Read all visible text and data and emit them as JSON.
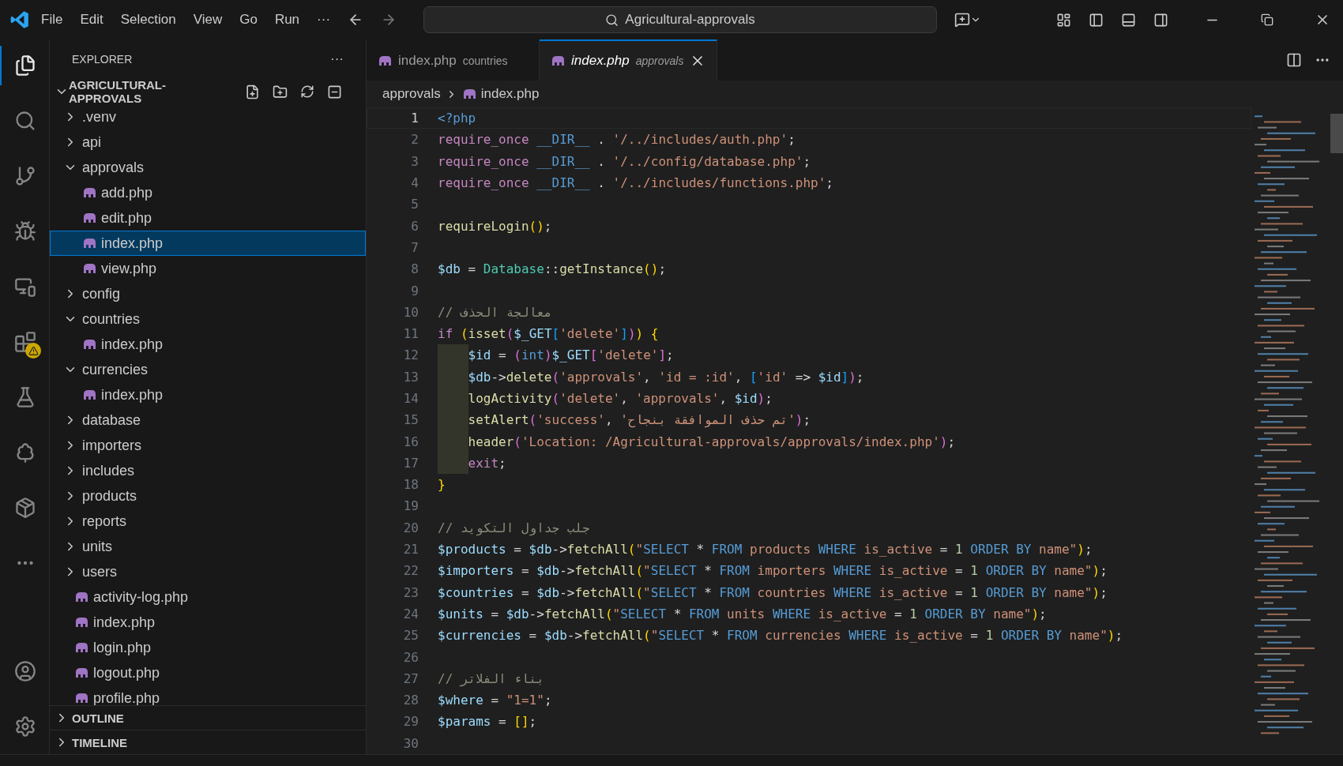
{
  "menu": [
    "File",
    "Edit",
    "Selection",
    "View",
    "Go",
    "Run",
    "···"
  ],
  "search": {
    "value": "Agricultural-approvals"
  },
  "sidebar": {
    "title": "EXPLORER",
    "more": "···",
    "root": {
      "label": "AGRICULTURAL-APPROVALS",
      "expanded": true
    },
    "tree": [
      {
        "label": ".venv",
        "kind": "folder",
        "expanded": false,
        "selected": false
      },
      {
        "label": "api",
        "kind": "folder",
        "expanded": false,
        "selected": false
      },
      {
        "label": "approvals",
        "kind": "folder",
        "expanded": true,
        "selected": false,
        "children": [
          {
            "label": "add.php",
            "kind": "file",
            "selected": false
          },
          {
            "label": "edit.php",
            "kind": "file",
            "selected": false
          },
          {
            "label": "index.php",
            "kind": "file",
            "selected": true
          },
          {
            "label": "view.php",
            "kind": "file",
            "selected": false
          }
        ]
      },
      {
        "label": "config",
        "kind": "folder",
        "expanded": false,
        "selected": false
      },
      {
        "label": "countries",
        "kind": "folder",
        "expanded": true,
        "selected": false,
        "children": [
          {
            "label": "index.php",
            "kind": "file",
            "selected": false
          }
        ]
      },
      {
        "label": "currencies",
        "kind": "folder",
        "expanded": true,
        "selected": false,
        "children": [
          {
            "label": "index.php",
            "kind": "file",
            "selected": false
          }
        ]
      },
      {
        "label": "database",
        "kind": "folder",
        "expanded": false,
        "selected": false
      },
      {
        "label": "importers",
        "kind": "folder",
        "expanded": false,
        "selected": false
      },
      {
        "label": "includes",
        "kind": "folder",
        "expanded": false,
        "selected": false
      },
      {
        "label": "products",
        "kind": "folder",
        "expanded": false,
        "selected": false
      },
      {
        "label": "reports",
        "kind": "folder",
        "expanded": false,
        "selected": false
      },
      {
        "label": "units",
        "kind": "folder",
        "expanded": false,
        "selected": false
      },
      {
        "label": "users",
        "kind": "folder",
        "expanded": false,
        "selected": false
      },
      {
        "label": "activity-log.php",
        "kind": "file",
        "selected": false
      },
      {
        "label": "index.php",
        "kind": "file",
        "selected": false
      },
      {
        "label": "login.php",
        "kind": "file",
        "selected": false
      },
      {
        "label": "logout.php",
        "kind": "file",
        "selected": false
      },
      {
        "label": "profile.php",
        "kind": "file",
        "selected": false
      }
    ],
    "sections": [
      {
        "label": "OUTLINE",
        "expanded": false
      },
      {
        "label": "TIMELINE",
        "expanded": false
      }
    ]
  },
  "tabs": [
    {
      "label": "index.php",
      "description": "countries",
      "selected": false,
      "preview": false
    },
    {
      "label": "index.php",
      "description": "approvals",
      "selected": true,
      "preview": true
    }
  ],
  "breadcrumb": [
    "approvals",
    "index.php"
  ],
  "lines": [
    {
      "number": "1",
      "current": true,
      "guide": false,
      "tokens": [
        {
          "kind": "tag",
          "text": "<?php"
        }
      ]
    },
    {
      "number": "2",
      "current": false,
      "guide": false,
      "tokens": [
        {
          "kind": "kw",
          "text": "require_once "
        },
        {
          "kind": "const",
          "text": "__DIR__"
        },
        {
          "kind": "plain",
          "text": " . "
        },
        {
          "kind": "str",
          "text": "'/../includes/auth.php'"
        },
        {
          "kind": "plain",
          "text": ";"
        }
      ]
    },
    {
      "number": "3",
      "current": false,
      "guide": false,
      "tokens": [
        {
          "kind": "kw",
          "text": "require_once "
        },
        {
          "kind": "const",
          "text": "__DIR__"
        },
        {
          "kind": "plain",
          "text": " . "
        },
        {
          "kind": "str",
          "text": "'/../config/database.php'"
        },
        {
          "kind": "plain",
          "text": ";"
        }
      ]
    },
    {
      "number": "4",
      "current": false,
      "guide": false,
      "tokens": [
        {
          "kind": "kw",
          "text": "require_once "
        },
        {
          "kind": "const",
          "text": "__DIR__"
        },
        {
          "kind": "plain",
          "text": " . "
        },
        {
          "kind": "str",
          "text": "'/../includes/functions.php'"
        },
        {
          "kind": "plain",
          "text": ";"
        }
      ]
    },
    {
      "number": "5",
      "current": false,
      "guide": false
    },
    {
      "number": "6",
      "current": false,
      "guide": false,
      "tokens": [
        {
          "kind": "fn",
          "text": "requireLogin"
        },
        {
          "kind": "b1",
          "text": "()"
        },
        {
          "kind": "plain",
          "text": ";"
        }
      ]
    },
    {
      "number": "7",
      "current": false,
      "guide": false
    },
    {
      "number": "8",
      "current": false,
      "guide": false,
      "tokens": [
        {
          "kind": "var",
          "text": "$db"
        },
        {
          "kind": "plain",
          "text": " = "
        },
        {
          "kind": "cls",
          "text": "Database"
        },
        {
          "kind": "plain",
          "text": "::"
        },
        {
          "kind": "fn",
          "text": "getInstance"
        },
        {
          "kind": "b1",
          "text": "()"
        },
        {
          "kind": "plain",
          "text": ";"
        }
      ]
    },
    {
      "number": "9",
      "current": false,
      "guide": false
    },
    {
      "number": "10",
      "current": false,
      "guide": false,
      "tokens": [
        {
          "kind": "cmt",
          "text": "// معالجة الحذف"
        }
      ]
    },
    {
      "number": "11",
      "current": false,
      "guide": false,
      "tokens": [
        {
          "kind": "kw",
          "text": "if "
        },
        {
          "kind": "b1",
          "text": "("
        },
        {
          "kind": "fn",
          "text": "isset"
        },
        {
          "kind": "b2",
          "text": "("
        },
        {
          "kind": "var",
          "text": "$_GET"
        },
        {
          "kind": "b3",
          "text": "["
        },
        {
          "kind": "str",
          "text": "'delete'"
        },
        {
          "kind": "b3",
          "text": "]"
        },
        {
          "kind": "b2",
          "text": ")"
        },
        {
          "kind": "b1",
          "text": ")"
        },
        {
          "kind": "b1",
          "text": " {"
        }
      ]
    },
    {
      "number": "12",
      "current": false,
      "guide": true,
      "tokens": [
        {
          "kind": "var",
          "text": "$id"
        },
        {
          "kind": "plain",
          "text": " = "
        },
        {
          "kind": "b2",
          "text": "("
        },
        {
          "kind": "const",
          "text": "int"
        },
        {
          "kind": "b2",
          "text": ")"
        },
        {
          "kind": "var",
          "text": "$_GET"
        },
        {
          "kind": "b2",
          "text": "["
        },
        {
          "kind": "str",
          "text": "'delete'"
        },
        {
          "kind": "b2",
          "text": "]"
        },
        {
          "kind": "plain",
          "text": ";"
        }
      ]
    },
    {
      "number": "13",
      "current": false,
      "guide": true,
      "tokens": [
        {
          "kind": "var",
          "text": "$db"
        },
        {
          "kind": "plain",
          "text": "->"
        },
        {
          "kind": "fn",
          "text": "delete"
        },
        {
          "kind": "b2",
          "text": "("
        },
        {
          "kind": "str",
          "text": "'approvals'"
        },
        {
          "kind": "plain",
          "text": ", "
        },
        {
          "kind": "str",
          "text": "'id = :id'"
        },
        {
          "kind": "plain",
          "text": ", "
        },
        {
          "kind": "b3",
          "text": "["
        },
        {
          "kind": "str",
          "text": "'id'"
        },
        {
          "kind": "plain",
          "text": " => "
        },
        {
          "kind": "var",
          "text": "$id"
        },
        {
          "kind": "b3",
          "text": "]"
        },
        {
          "kind": "b2",
          "text": ")"
        },
        {
          "kind": "plain",
          "text": ";"
        }
      ]
    },
    {
      "number": "14",
      "current": false,
      "guide": true,
      "tokens": [
        {
          "kind": "fn",
          "text": "logActivity"
        },
        {
          "kind": "b2",
          "text": "("
        },
        {
          "kind": "str",
          "text": "'delete'"
        },
        {
          "kind": "plain",
          "text": ", "
        },
        {
          "kind": "str",
          "text": "'approvals'"
        },
        {
          "kind": "plain",
          "text": ", "
        },
        {
          "kind": "var",
          "text": "$id"
        },
        {
          "kind": "b2",
          "text": ")"
        },
        {
          "kind": "plain",
          "text": ";"
        }
      ]
    },
    {
      "number": "15",
      "current": false,
      "guide": true,
      "tokens": [
        {
          "kind": "fn",
          "text": "setAlert"
        },
        {
          "kind": "b2",
          "text": "("
        },
        {
          "kind": "str",
          "text": "'success'"
        },
        {
          "kind": "plain",
          "text": ", "
        },
        {
          "kind": "str",
          "text": "'تم حذف الموافقة بنجاح'"
        },
        {
          "kind": "b2",
          "text": ")"
        },
        {
          "kind": "plain",
          "text": ";"
        }
      ]
    },
    {
      "number": "16",
      "current": false,
      "guide": true,
      "tokens": [
        {
          "kind": "fn",
          "text": "header"
        },
        {
          "kind": "b2",
          "text": "("
        },
        {
          "kind": "str",
          "text": "'Location: /Agricultural-approvals/approvals/index.php'"
        },
        {
          "kind": "b2",
          "text": ")"
        },
        {
          "kind": "plain",
          "text": ";"
        }
      ]
    },
    {
      "number": "17",
      "current": false,
      "guide": true,
      "tokens": [
        {
          "kind": "kw",
          "text": "exit"
        },
        {
          "kind": "plain",
          "text": ";"
        }
      ]
    },
    {
      "number": "18",
      "current": false,
      "guide": false,
      "tokens": [
        {
          "kind": "b1",
          "text": "}"
        }
      ]
    },
    {
      "number": "19",
      "current": false,
      "guide": false
    },
    {
      "number": "20",
      "current": false,
      "guide": false,
      "tokens": [
        {
          "kind": "cmt",
          "text": "// جلب جداول التكويد"
        }
      ]
    },
    {
      "number": "21",
      "current": false,
      "guide": false,
      "tokens": [
        {
          "kind": "var",
          "text": "$products"
        },
        {
          "kind": "plain",
          "text": " = "
        },
        {
          "kind": "var",
          "text": "$db"
        },
        {
          "kind": "plain",
          "text": "->"
        },
        {
          "kind": "fn",
          "text": "fetchAll"
        },
        {
          "kind": "b1",
          "text": "("
        },
        {
          "kind": "str",
          "text": "\""
        },
        {
          "kind": "sql",
          "text": "SELECT"
        },
        {
          "kind": "plain",
          "text": " * "
        },
        {
          "kind": "sql",
          "text": "FROM"
        },
        {
          "kind": "str",
          "text": " products "
        },
        {
          "kind": "sql",
          "text": "WHERE"
        },
        {
          "kind": "str",
          "text": " is_active "
        },
        {
          "kind": "plain",
          "text": "= "
        },
        {
          "kind": "num",
          "text": "1"
        },
        {
          "kind": "sql",
          "text": " ORDER BY"
        },
        {
          "kind": "str",
          "text": " name\""
        },
        {
          "kind": "b1",
          "text": ")"
        },
        {
          "kind": "plain",
          "text": ";"
        }
      ]
    },
    {
      "number": "22",
      "current": false,
      "guide": false,
      "tokens": [
        {
          "kind": "var",
          "text": "$importers"
        },
        {
          "kind": "plain",
          "text": " = "
        },
        {
          "kind": "var",
          "text": "$db"
        },
        {
          "kind": "plain",
          "text": "->"
        },
        {
          "kind": "fn",
          "text": "fetchAll"
        },
        {
          "kind": "b1",
          "text": "("
        },
        {
          "kind": "str",
          "text": "\""
        },
        {
          "kind": "sql",
          "text": "SELECT"
        },
        {
          "kind": "plain",
          "text": " * "
        },
        {
          "kind": "sql",
          "text": "FROM"
        },
        {
          "kind": "str",
          "text": " importers "
        },
        {
          "kind": "sql",
          "text": "WHERE"
        },
        {
          "kind": "str",
          "text": " is_active "
        },
        {
          "kind": "plain",
          "text": "= "
        },
        {
          "kind": "num",
          "text": "1"
        },
        {
          "kind": "sql",
          "text": " ORDER BY"
        },
        {
          "kind": "str",
          "text": " name\""
        },
        {
          "kind": "b1",
          "text": ")"
        },
        {
          "kind": "plain",
          "text": ";"
        }
      ]
    },
    {
      "number": "23",
      "current": false,
      "guide": false,
      "tokens": [
        {
          "kind": "var",
          "text": "$countries"
        },
        {
          "kind": "plain",
          "text": " = "
        },
        {
          "kind": "var",
          "text": "$db"
        },
        {
          "kind": "plain",
          "text": "->"
        },
        {
          "kind": "fn",
          "text": "fetchAll"
        },
        {
          "kind": "b1",
          "text": "("
        },
        {
          "kind": "str",
          "text": "\""
        },
        {
          "kind": "sql",
          "text": "SELECT"
        },
        {
          "kind": "plain",
          "text": " * "
        },
        {
          "kind": "sql",
          "text": "FROM"
        },
        {
          "kind": "str",
          "text": " countries "
        },
        {
          "kind": "sql",
          "text": "WHERE"
        },
        {
          "kind": "str",
          "text": " is_active "
        },
        {
          "kind": "plain",
          "text": "= "
        },
        {
          "kind": "num",
          "text": "1"
        },
        {
          "kind": "sql",
          "text": " ORDER BY"
        },
        {
          "kind": "str",
          "text": " name\""
        },
        {
          "kind": "b1",
          "text": ")"
        },
        {
          "kind": "plain",
          "text": ";"
        }
      ]
    },
    {
      "number": "24",
      "current": false,
      "guide": false,
      "tokens": [
        {
          "kind": "var",
          "text": "$units"
        },
        {
          "kind": "plain",
          "text": " = "
        },
        {
          "kind": "var",
          "text": "$db"
        },
        {
          "kind": "plain",
          "text": "->"
        },
        {
          "kind": "fn",
          "text": "fetchAll"
        },
        {
          "kind": "b1",
          "text": "("
        },
        {
          "kind": "str",
          "text": "\""
        },
        {
          "kind": "sql",
          "text": "SELECT"
        },
        {
          "kind": "plain",
          "text": " * "
        },
        {
          "kind": "sql",
          "text": "FROM"
        },
        {
          "kind": "str",
          "text": " units "
        },
        {
          "kind": "sql",
          "text": "WHERE"
        },
        {
          "kind": "str",
          "text": " is_active "
        },
        {
          "kind": "plain",
          "text": "= "
        },
        {
          "kind": "num",
          "text": "1"
        },
        {
          "kind": "sql",
          "text": " ORDER BY"
        },
        {
          "kind": "str",
          "text": " name\""
        },
        {
          "kind": "b1",
          "text": ")"
        },
        {
          "kind": "plain",
          "text": ";"
        }
      ]
    },
    {
      "number": "25",
      "current": false,
      "guide": false,
      "tokens": [
        {
          "kind": "var",
          "text": "$currencies"
        },
        {
          "kind": "plain",
          "text": " = "
        },
        {
          "kind": "var",
          "text": "$db"
        },
        {
          "kind": "plain",
          "text": "->"
        },
        {
          "kind": "fn",
          "text": "fetchAll"
        },
        {
          "kind": "b1",
          "text": "("
        },
        {
          "kind": "str",
          "text": "\""
        },
        {
          "kind": "sql",
          "text": "SELECT"
        },
        {
          "kind": "plain",
          "text": " * "
        },
        {
          "kind": "sql",
          "text": "FROM"
        },
        {
          "kind": "str",
          "text": " currencies "
        },
        {
          "kind": "sql",
          "text": "WHERE"
        },
        {
          "kind": "str",
          "text": " is_active "
        },
        {
          "kind": "plain",
          "text": "= "
        },
        {
          "kind": "num",
          "text": "1"
        },
        {
          "kind": "sql",
          "text": " ORDER BY"
        },
        {
          "kind": "str",
          "text": " name\""
        },
        {
          "kind": "b1",
          "text": ")"
        },
        {
          "kind": "plain",
          "text": ";"
        }
      ]
    },
    {
      "number": "26",
      "current": false,
      "guide": false
    },
    {
      "number": "27",
      "current": false,
      "guide": false,
      "tokens": [
        {
          "kind": "cmt",
          "text": "// بناء الفلاتر"
        }
      ]
    },
    {
      "number": "28",
      "current": false,
      "guide": false,
      "tokens": [
        {
          "kind": "var",
          "text": "$where"
        },
        {
          "kind": "plain",
          "text": " = "
        },
        {
          "kind": "str",
          "text": "\"1=1\""
        },
        {
          "kind": "plain",
          "text": ";"
        }
      ]
    },
    {
      "number": "29",
      "current": false,
      "guide": false,
      "tokens": [
        {
          "kind": "var",
          "text": "$params"
        },
        {
          "kind": "plain",
          "text": " = "
        },
        {
          "kind": "b1",
          "text": "[]"
        },
        {
          "kind": "plain",
          "text": ";"
        }
      ]
    },
    {
      "number": "30",
      "current": false,
      "guide": false
    }
  ]
}
